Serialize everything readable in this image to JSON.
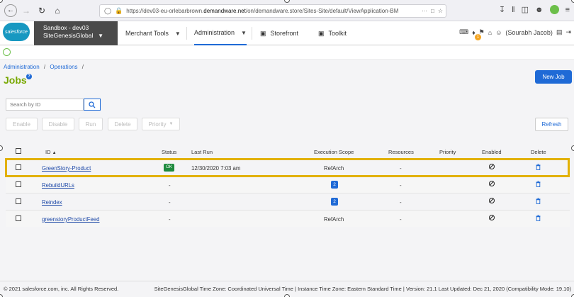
{
  "browser": {
    "url_prefix": "https://dev03-eu-orlebarbrown.",
    "url_domain": "demandware.net",
    "url_suffix": "/on/demandware.store/Sites-Site/default/ViewApplication-BM",
    "url_more": "···"
  },
  "header": {
    "logo_text": "salesforce",
    "site_line1": "Sandbox - dev03",
    "site_line2": "SiteGenesisGlobal",
    "menu": [
      {
        "label": "Merchant Tools"
      },
      {
        "label": "Administration"
      },
      {
        "label": "Storefront"
      },
      {
        "label": "Toolkit"
      }
    ],
    "notification_count": "1",
    "user": "(Sourabh Jacob)"
  },
  "breadcrumb": {
    "items": [
      "Administration",
      "Operations"
    ],
    "sep": "/"
  },
  "page": {
    "title": "Jobs",
    "help": "?",
    "new_job": "New Job"
  },
  "search": {
    "placeholder": "Search by ID"
  },
  "actions": {
    "enable": "Enable",
    "disable": "Disable",
    "run": "Run",
    "delete": "Delete",
    "priority": "Priority",
    "refresh": "Refresh"
  },
  "table": {
    "headers": {
      "id": "ID",
      "status": "Status",
      "last_run": "Last Run",
      "scope": "Execution Scope",
      "resources": "Resources",
      "priority": "Priority",
      "enabled": "Enabled",
      "delete": "Delete"
    },
    "rows": [
      {
        "id": "GreenStory-Product",
        "status": "OK",
        "last_run": "12/30/2020 7:03 am",
        "scope": "RefArch",
        "resources": "-"
      },
      {
        "id": "RebuildURLs",
        "status": "-",
        "last_run": "",
        "scope": "2",
        "resources": "-"
      },
      {
        "id": "Reindex",
        "status": "-",
        "last_run": "",
        "scope": "2",
        "resources": "-"
      },
      {
        "id": "greenstoryProductFeed",
        "status": "-",
        "last_run": "",
        "scope": "RefArch",
        "resources": "-"
      }
    ]
  },
  "footer": {
    "copyright": "© 2021 salesforce.com, inc. All Rights Reserved.",
    "info": "SiteGenesisGlobal Time Zone: Coordinated Universal Time | Instance Time Zone: Eastern Standard Time | Version: 21.1 Last Updated: Dec 21, 2020 (Compatibility Mode: 19.10)"
  },
  "colors": {
    "accent": "#1f6ad6",
    "title_green": "#78a800",
    "highlight": "#e2b100",
    "ok_green": "#1e8a3e"
  }
}
